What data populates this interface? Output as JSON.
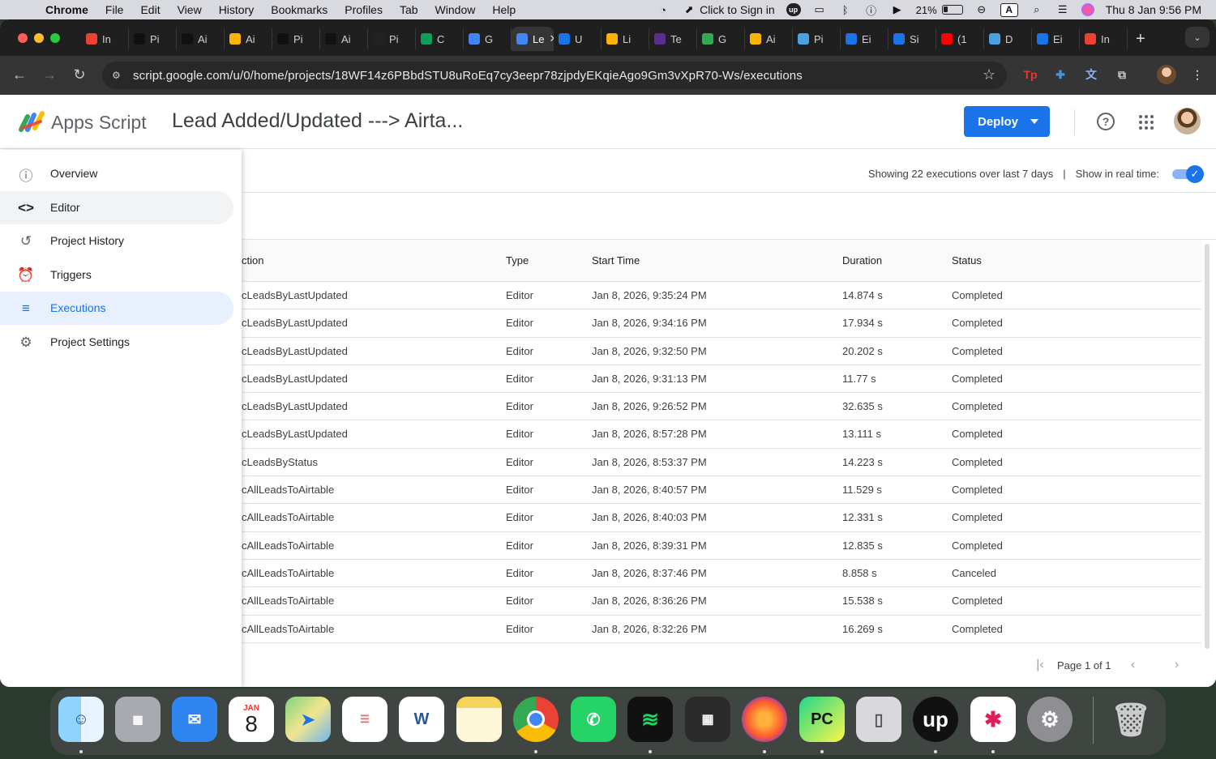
{
  "menubar": {
    "app": "Chrome",
    "items": [
      "File",
      "Edit",
      "View",
      "History",
      "Bookmarks",
      "Profiles",
      "Tab",
      "Window",
      "Help"
    ],
    "sign_in": "Click to Sign in",
    "battery": "21%",
    "input_source": "A",
    "datetime": "Thu 8 Jan  9:56 PM"
  },
  "tabs": [
    {
      "label": "In",
      "icon": "gmail-icon",
      "color": "#ea4335"
    },
    {
      "label": "Pi",
      "icon": "upwork-icon",
      "color": "#111111"
    },
    {
      "label": "Ai",
      "icon": "upwork-icon",
      "color": "#111111"
    },
    {
      "label": "Ai",
      "icon": "airtable-icon",
      "color": "#fcb400"
    },
    {
      "label": "Pi",
      "icon": "upwork-icon",
      "color": "#111111"
    },
    {
      "label": "Ai",
      "icon": "upwork-icon",
      "color": "#111111"
    },
    {
      "label": "Pi",
      "icon": "openai-icon",
      "color": "#222222"
    },
    {
      "label": "C",
      "icon": "sheets-icon",
      "color": "#0f9d58"
    },
    {
      "label": "G",
      "icon": "gemini-icon",
      "color": "#4285f4"
    },
    {
      "label": "Le",
      "icon": "apps-script-icon",
      "color": "#4285f4",
      "active": true
    },
    {
      "label": "U",
      "icon": "link-icon",
      "color": "#1a73e8"
    },
    {
      "label": "Li",
      "icon": "airtable-icon",
      "color": "#fcb400"
    },
    {
      "label": "Te",
      "icon": "tool-icon",
      "color": "#5c2d91"
    },
    {
      "label": "G",
      "icon": "ads-icon",
      "color": "#34a853"
    },
    {
      "label": "Ai",
      "icon": "airtable-icon",
      "color": "#fcb400"
    },
    {
      "label": "Pi",
      "icon": "plus-icon",
      "color": "#4aa3df"
    },
    {
      "label": "Ei",
      "icon": "circle-icon",
      "color": "#1a73e8"
    },
    {
      "label": "Si",
      "icon": "circle-icon",
      "color": "#1a73e8"
    },
    {
      "label": "(1",
      "icon": "youtube-icon",
      "color": "#ff0000"
    },
    {
      "label": "D",
      "icon": "plus-icon",
      "color": "#4aa3df"
    },
    {
      "label": "Ei",
      "icon": "circle-icon",
      "color": "#1a73e8"
    },
    {
      "label": "In",
      "icon": "gmail-icon",
      "color": "#ea4335"
    }
  ],
  "address_bar": {
    "url": "script.google.com/u/0/home/projects/18WF14z6PBbdSTU8uRoEq7cy3eepr78zjpdyEKqieAgo9Gm3vXpR70-Ws/executions"
  },
  "appbar": {
    "product": "Apps Script",
    "project_title": "Lead Added/Updated ---> Airta...",
    "deploy_label": "Deploy"
  },
  "sidebar": {
    "items": [
      {
        "label": "Overview",
        "icon": "info-icon"
      },
      {
        "label": "Editor",
        "icon": "code-icon"
      },
      {
        "label": "Project History",
        "icon": "history-icon"
      },
      {
        "label": "Triggers",
        "icon": "alarm-icon"
      },
      {
        "label": "Executions",
        "icon": "executions-list-icon"
      },
      {
        "label": "Project Settings",
        "icon": "gear-icon"
      }
    ]
  },
  "executions": {
    "summary": "Showing 22 executions over last 7 days",
    "realtime_label": "Show in real time:",
    "realtime_on": true,
    "columns": [
      "ction",
      "Type",
      "Start Time",
      "Duration",
      "Status"
    ],
    "rows": [
      {
        "fn": "cLeadsByLastUpdated",
        "type": "Editor",
        "start": "Jan 8, 2026, 9:35:24 PM",
        "duration": "14.874 s",
        "status": "Completed"
      },
      {
        "fn": "cLeadsByLastUpdated",
        "type": "Editor",
        "start": "Jan 8, 2026, 9:34:16 PM",
        "duration": "17.934 s",
        "status": "Completed"
      },
      {
        "fn": "cLeadsByLastUpdated",
        "type": "Editor",
        "start": "Jan 8, 2026, 9:32:50 PM",
        "duration": "20.202 s",
        "status": "Completed"
      },
      {
        "fn": "cLeadsByLastUpdated",
        "type": "Editor",
        "start": "Jan 8, 2026, 9:31:13 PM",
        "duration": "11.77 s",
        "status": "Completed"
      },
      {
        "fn": "cLeadsByLastUpdated",
        "type": "Editor",
        "start": "Jan 8, 2026, 9:26:52 PM",
        "duration": "32.635 s",
        "status": "Completed"
      },
      {
        "fn": "cLeadsByLastUpdated",
        "type": "Editor",
        "start": "Jan 8, 2026, 8:57:28 PM",
        "duration": "13.111 s",
        "status": "Completed"
      },
      {
        "fn": "cLeadsByStatus",
        "type": "Editor",
        "start": "Jan 8, 2026, 8:53:37 PM",
        "duration": "14.223 s",
        "status": "Completed"
      },
      {
        "fn": "cAllLeadsToAirtable",
        "type": "Editor",
        "start": "Jan 8, 2026, 8:40:57 PM",
        "duration": "11.529 s",
        "status": "Completed"
      },
      {
        "fn": "cAllLeadsToAirtable",
        "type": "Editor",
        "start": "Jan 8, 2026, 8:40:03 PM",
        "duration": "12.331 s",
        "status": "Completed"
      },
      {
        "fn": "cAllLeadsToAirtable",
        "type": "Editor",
        "start": "Jan 8, 2026, 8:39:31 PM",
        "duration": "12.835 s",
        "status": "Completed"
      },
      {
        "fn": "cAllLeadsToAirtable",
        "type": "Editor",
        "start": "Jan 8, 2026, 8:37:46 PM",
        "duration": "8.858 s",
        "status": "Canceled"
      },
      {
        "fn": "cAllLeadsToAirtable",
        "type": "Editor",
        "start": "Jan 8, 2026, 8:36:26 PM",
        "duration": "15.538 s",
        "status": "Completed"
      },
      {
        "fn": "cAllLeadsToAirtable",
        "type": "Editor",
        "start": "Jan 8, 2026, 8:32:26 PM",
        "duration": "16.269 s",
        "status": "Completed"
      }
    ],
    "pagination": "Page 1 of 1"
  },
  "dock": {
    "calendar_month": "JAN",
    "calendar_day": "8",
    "items": [
      "finder-icon",
      "launchpad-icon",
      "mail-icon",
      "calendar-icon",
      "maps-icon",
      "reminders-icon",
      "word-icon",
      "notes-icon",
      "chrome-icon",
      "whatsapp-icon",
      "spotify-icon",
      "calculator-icon",
      "firefox-icon",
      "pycharm-icon",
      "iphone-mirroring-icon",
      "upwork-icon",
      "slack-icon",
      "system-settings-icon",
      "trash-icon"
    ]
  },
  "colors": {
    "accent": "#1a73e8",
    "active_nav_bg": "#e8f0fe",
    "chrome_dark": "#1f1f1f"
  }
}
